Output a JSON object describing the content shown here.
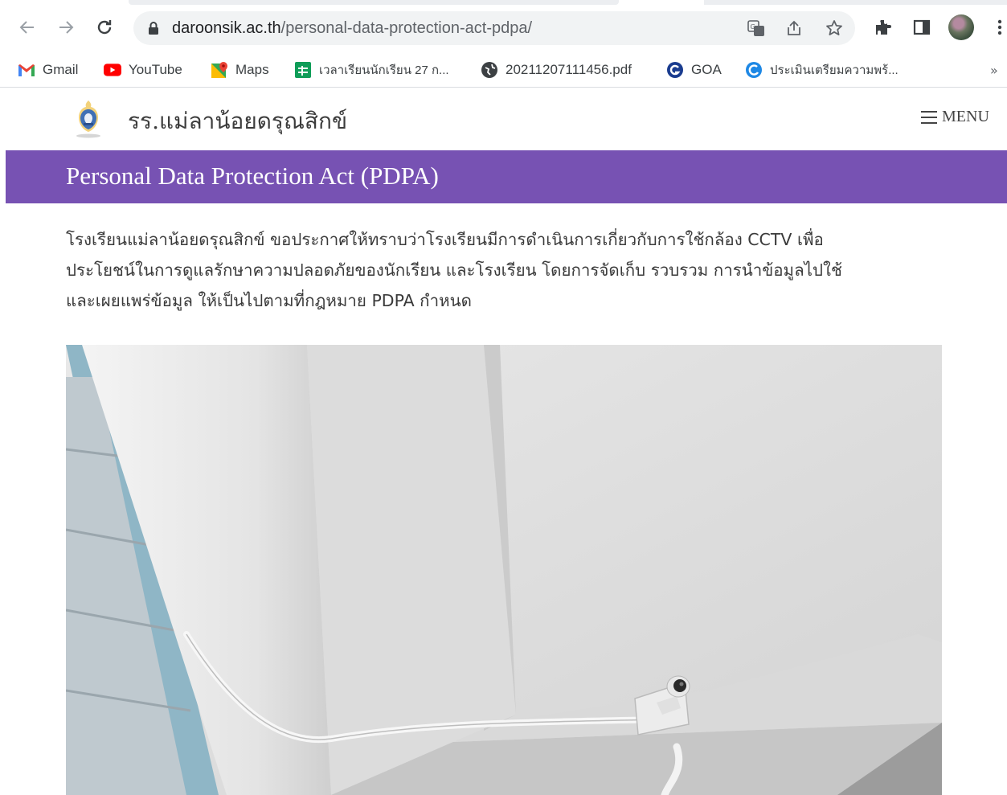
{
  "browser": {
    "url_host": "daroonsik.ac.th",
    "url_path": "/personal-data-protection-act-pdpa/",
    "bookmarks": [
      {
        "label": "Gmail",
        "icon": "gmail-icon"
      },
      {
        "label": "YouTube",
        "icon": "youtube-icon"
      },
      {
        "label": "Maps",
        "icon": "maps-icon"
      },
      {
        "label": "เวลาเรียนนักเรียน 27 ก...",
        "icon": "sheets-icon"
      },
      {
        "label": "20211207111456.pdf",
        "icon": "globe-icon"
      },
      {
        "label": "GOA",
        "icon": "goa-icon"
      },
      {
        "label": "ประเมินเตรียมความพร้...",
        "icon": "chrome-web-icon"
      }
    ],
    "bookmarks_overflow": "»"
  },
  "site": {
    "name": "รร.แม่ลาน้อยดรุณสิกข์",
    "menu_label": "MENU"
  },
  "page": {
    "title": "Personal Data Protection Act (PDPA)",
    "intro_line1": "โรงเรียนแม่ลาน้อยดรุณสิกข์ ขอประกาศให้ทราบว่าโรงเรียนมีการดำเนินการเกี่ยวกับการใช้กล้อง CCTV เพื่อ",
    "intro_line2": "ประโยชน์ในการดูแลรักษาความปลอดภัยของนักเรียน และโรงเรียน โดยการจัดเก็บ รวบรวม การนำข้อมูลไปใช้",
    "intro_line3": "และเผยแพร่ข้อมูล ให้เป็นไปตามที่กฎหมาย PDPA กำหนด"
  },
  "colors": {
    "title_bar": "#7752b3",
    "omnibox": "#f1f3f4"
  }
}
